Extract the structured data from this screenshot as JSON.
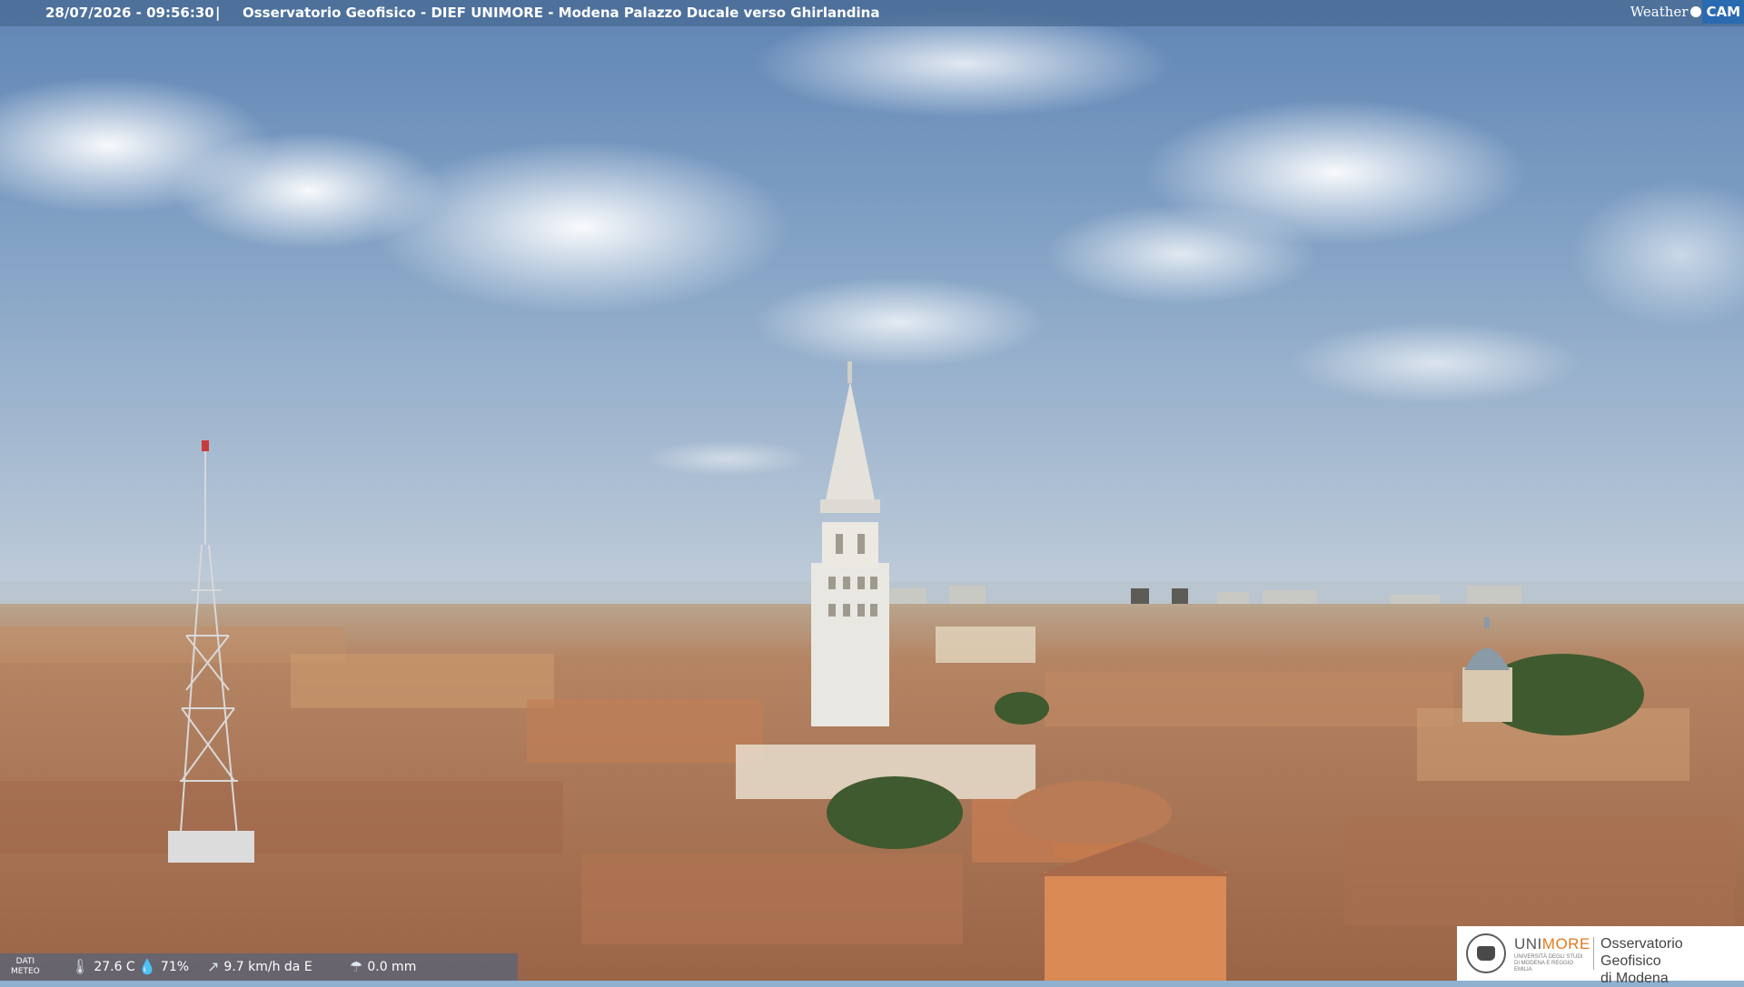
{
  "topbar": {
    "timestamp": "28/07/2026 - 09:56:30",
    "separator": "|",
    "caption": "Osservatorio Geofisico - DIEF UNIMORE - Modena Palazzo Ducale verso Ghirlandina"
  },
  "logo": {
    "weather_text": "Weather",
    "cam_text": "CAM"
  },
  "weather_bar": {
    "label_line1": "DATI",
    "label_line2": "METEO",
    "temperature": "27.6 C",
    "humidity": "71%",
    "wind": "9.7 km/h da E",
    "rain": "0.0 mm",
    "icons": [
      "thermometer-icon",
      "humidity-drop-icon",
      "wind-icon",
      "rain-gauge-icon"
    ]
  },
  "branding": {
    "university_prefix": "UNI",
    "university_suffix": "MORE",
    "university_subtitle": "UNIVERSITÀ DEGLI STUDI DI MODENA E REGGIO EMILIA",
    "observatory_line1": "Osservatorio Geofisico",
    "observatory_line2": "di Modena"
  },
  "colors": {
    "sky_top": "#5f85b5",
    "sky_horizon": "#c3ceda",
    "roofs": "#a8704d",
    "accent_orange": "#e07a1f"
  }
}
